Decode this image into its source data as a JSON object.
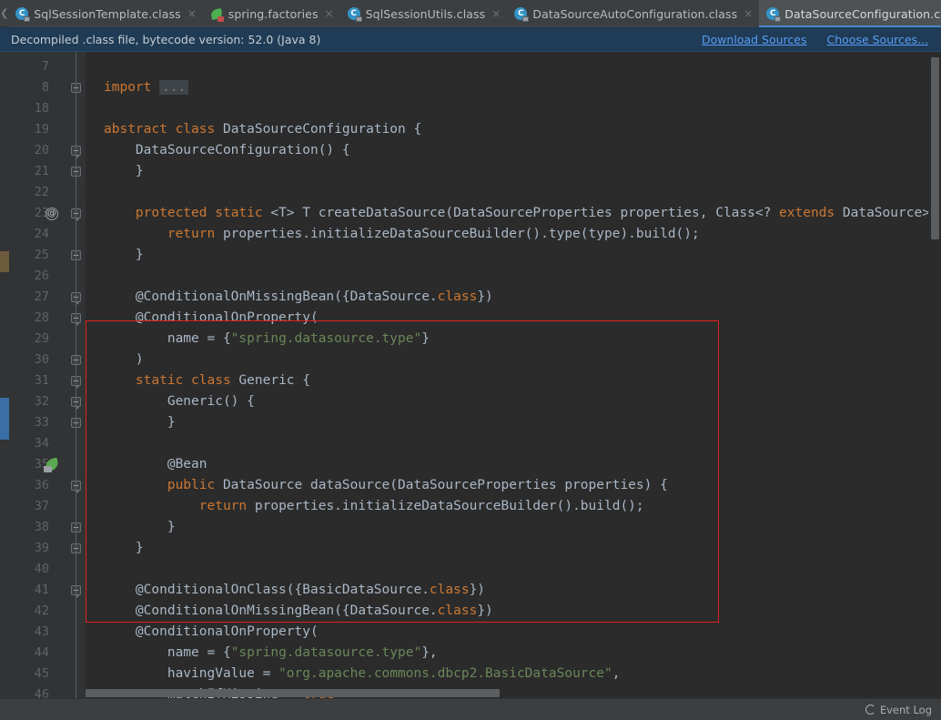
{
  "tabs": {
    "scroll_left_icon": "chevron-left-icon",
    "dropdown_icon": "chevron-down-icon",
    "items": [
      {
        "label": "SqlSessionTemplate.class",
        "icon": "java-class-icon",
        "active": false,
        "close": "×"
      },
      {
        "label": "spring.factories",
        "icon": "spring-factories-icon",
        "active": false,
        "close": "×"
      },
      {
        "label": "SqlSessionUtils.class",
        "icon": "java-class-icon",
        "active": false,
        "close": "×"
      },
      {
        "label": "DataSourceAutoConfiguration.class",
        "icon": "java-class-icon",
        "active": false,
        "close": "×"
      },
      {
        "label": "DataSourceConfiguration.class",
        "icon": "java-class-icon",
        "active": true,
        "close": "×"
      }
    ]
  },
  "notification": {
    "message": "Decompiled .class file, bytecode version: 52.0 (Java 8)",
    "download_sources": "Download Sources",
    "choose_sources": "Choose Sources...",
    "background": "#1f3b55",
    "link_color": "#589df6"
  },
  "editor": {
    "background": "#2b2b2b",
    "gutter_background": "#313335",
    "highlight_box_color": "#e02020",
    "lines": [
      {
        "n": "7",
        "tokens": []
      },
      {
        "n": "8",
        "tokens": [
          {
            "t": "import ",
            "c": "kw"
          },
          {
            "t": "...",
            "c": "fold-placeholder"
          }
        ],
        "fold": "plus"
      },
      {
        "n": "18",
        "tokens": []
      },
      {
        "n": "19",
        "tokens": [
          {
            "t": "abstract ",
            "c": "kw"
          },
          {
            "t": "class ",
            "c": "kw"
          },
          {
            "t": "DataSourceConfiguration {",
            "c": "plain"
          }
        ]
      },
      {
        "n": "20",
        "tokens": [
          {
            "t": "    DataSourceConfiguration() {",
            "c": "plain"
          }
        ],
        "fold": "down"
      },
      {
        "n": "21",
        "tokens": [
          {
            "t": "    }",
            "c": "plain"
          }
        ],
        "fold": "end"
      },
      {
        "n": "22",
        "tokens": []
      },
      {
        "n": "23",
        "tokens": [
          {
            "t": "    ",
            "c": "plain"
          },
          {
            "t": "protected ",
            "c": "kw"
          },
          {
            "t": "static ",
            "c": "kw"
          },
          {
            "t": "<T> T createDataSource(DataSourceProperties properties, Class<? ",
            "c": "plain"
          },
          {
            "t": "extends ",
            "c": "kw"
          },
          {
            "t": "DataSource> t",
            "c": "plain"
          }
        ],
        "fold": "down",
        "gutter_icon": "annotation-at-icon"
      },
      {
        "n": "24",
        "tokens": [
          {
            "t": "        ",
            "c": "plain"
          },
          {
            "t": "return ",
            "c": "kw"
          },
          {
            "t": "properties.initializeDataSourceBuilder().type(type).build();",
            "c": "plain"
          }
        ]
      },
      {
        "n": "25",
        "tokens": [
          {
            "t": "    }",
            "c": "plain"
          }
        ],
        "fold": "end"
      },
      {
        "n": "26",
        "tokens": []
      },
      {
        "n": "27",
        "tokens": [
          {
            "t": "    @ConditionalOnMissingBean({DataSource.",
            "c": "plain"
          },
          {
            "t": "class",
            "c": "kw"
          },
          {
            "t": "})",
            "c": "plain"
          }
        ],
        "fold": "down"
      },
      {
        "n": "28",
        "tokens": [
          {
            "t": "    @ConditionalOnProperty(",
            "c": "plain"
          }
        ],
        "fold": "down"
      },
      {
        "n": "29",
        "tokens": [
          {
            "t": "        name = {",
            "c": "plain"
          },
          {
            "t": "\"spring.datasource.type\"",
            "c": "str"
          },
          {
            "t": "}",
            "c": "plain"
          }
        ]
      },
      {
        "n": "30",
        "tokens": [
          {
            "t": "    )",
            "c": "plain"
          }
        ],
        "fold": "end"
      },
      {
        "n": "31",
        "tokens": [
          {
            "t": "    ",
            "c": "plain"
          },
          {
            "t": "static ",
            "c": "kw"
          },
          {
            "t": "class ",
            "c": "kw"
          },
          {
            "t": "Generic {",
            "c": "plain"
          }
        ],
        "fold": "down"
      },
      {
        "n": "32",
        "tokens": [
          {
            "t": "        Generic() {",
            "c": "plain"
          }
        ],
        "fold": "down"
      },
      {
        "n": "33",
        "tokens": [
          {
            "t": "        }",
            "c": "plain"
          }
        ],
        "fold": "end"
      },
      {
        "n": "34",
        "tokens": []
      },
      {
        "n": "35",
        "tokens": [
          {
            "t": "        @Bean",
            "c": "plain"
          }
        ],
        "gutter_icon": "spring-bean-icon"
      },
      {
        "n": "36",
        "tokens": [
          {
            "t": "        ",
            "c": "plain"
          },
          {
            "t": "public ",
            "c": "kw"
          },
          {
            "t": "DataSource dataSource(DataSourceProperties properties) {",
            "c": "plain"
          }
        ],
        "fold": "down"
      },
      {
        "n": "37",
        "tokens": [
          {
            "t": "            ",
            "c": "plain"
          },
          {
            "t": "return ",
            "c": "kw"
          },
          {
            "t": "properties.initializeDataSourceBuilder().build();",
            "c": "plain"
          }
        ]
      },
      {
        "n": "38",
        "tokens": [
          {
            "t": "        }",
            "c": "plain"
          }
        ],
        "fold": "end"
      },
      {
        "n": "39",
        "tokens": [
          {
            "t": "    }",
            "c": "plain"
          }
        ],
        "fold": "end"
      },
      {
        "n": "40",
        "tokens": []
      },
      {
        "n": "41",
        "tokens": [
          {
            "t": "    @ConditionalOnClass({BasicDataSource.",
            "c": "plain"
          },
          {
            "t": "class",
            "c": "kw"
          },
          {
            "t": "})",
            "c": "plain"
          }
        ],
        "fold": "down"
      },
      {
        "n": "42",
        "tokens": [
          {
            "t": "    @ConditionalOnMissingBean({DataSource.",
            "c": "plain"
          },
          {
            "t": "class",
            "c": "kw"
          },
          {
            "t": "})",
            "c": "plain"
          }
        ]
      },
      {
        "n": "43",
        "tokens": [
          {
            "t": "    @ConditionalOnProperty(",
            "c": "plain"
          }
        ]
      },
      {
        "n": "44",
        "tokens": [
          {
            "t": "        name = {",
            "c": "plain"
          },
          {
            "t": "\"spring.datasource.type\"",
            "c": "str"
          },
          {
            "t": "},",
            "c": "plain"
          }
        ]
      },
      {
        "n": "45",
        "tokens": [
          {
            "t": "        havingValue = ",
            "c": "plain"
          },
          {
            "t": "\"org.apache.commons.dbcp2.BasicDataSource\"",
            "c": "str"
          },
          {
            "t": ",",
            "c": "plain"
          }
        ]
      },
      {
        "n": "46",
        "tokens": [
          {
            "t": "        matchIfMissing = ",
            "c": "plain"
          },
          {
            "t": "true",
            "c": "kw"
          }
        ]
      }
    ],
    "vertical_scrollbar": "vertical-scrollbar",
    "horizontal_scrollbar": "horizontal-scrollbar"
  },
  "statusbar": {
    "event_log": "Event Log",
    "event_log_icon": "event-log-icon"
  }
}
